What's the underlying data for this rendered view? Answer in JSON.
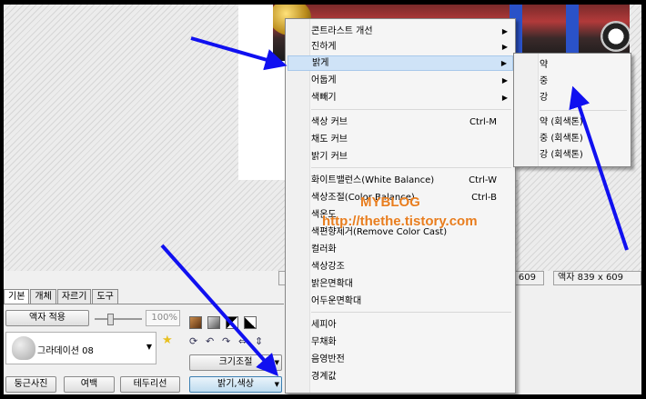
{
  "status_bar": {
    "left_value": "609",
    "right_value": "액자 839 x 609"
  },
  "tabs": [
    {
      "label": "기본"
    },
    {
      "label": "개체"
    },
    {
      "label": "자르기"
    },
    {
      "label": "도구"
    }
  ],
  "panel": {
    "frame_apply": "액자 적용",
    "zoom_value": "100%",
    "gradient_name": "그라데이션 08",
    "resize_button": "크기조절",
    "round_photo": "둥근사진",
    "margin": "여백",
    "border_line": "테두리선",
    "brightness_color": "밝기,색상"
  },
  "menu": {
    "items": [
      {
        "label": "콘트라스트 개선",
        "shortcut": "",
        "submenu": true
      },
      {
        "label": "진하게",
        "shortcut": "",
        "submenu": true
      },
      {
        "label": "밝게",
        "shortcut": "",
        "submenu": true
      },
      {
        "label": "어둡게",
        "shortcut": "",
        "submenu": true
      },
      {
        "label": "색빼기",
        "shortcut": "",
        "submenu": true
      },
      {
        "label": "색상 커브",
        "shortcut": "Ctrl-M",
        "submenu": false
      },
      {
        "label": "채도 커브",
        "shortcut": "",
        "submenu": false
      },
      {
        "label": "밝기 커브",
        "shortcut": "",
        "submenu": false
      },
      {
        "label": "화이트밸런스(White Balance)",
        "shortcut": "Ctrl-W",
        "submenu": false
      },
      {
        "label": "색상조절(Color Balance)",
        "shortcut": "Ctrl-B",
        "submenu": false
      },
      {
        "label": "색온도",
        "shortcut": "",
        "submenu": false
      },
      {
        "label": "색편향제거(Remove Color Cast)",
        "shortcut": "",
        "submenu": false
      },
      {
        "label": "컬러화",
        "shortcut": "",
        "submenu": false
      },
      {
        "label": "색상강조",
        "shortcut": "",
        "submenu": false
      },
      {
        "label": "밝은면확대",
        "shortcut": "",
        "submenu": false
      },
      {
        "label": "어두운면확대",
        "shortcut": "",
        "submenu": false
      },
      {
        "label": "세피아",
        "shortcut": "",
        "submenu": false
      },
      {
        "label": "무채화",
        "shortcut": "",
        "submenu": false
      },
      {
        "label": "음영반전",
        "shortcut": "",
        "submenu": false
      },
      {
        "label": "경계값",
        "shortcut": "",
        "submenu": false
      }
    ]
  },
  "submenu": {
    "items": [
      {
        "label": "약"
      },
      {
        "label": "중"
      },
      {
        "label": "강"
      },
      {
        "label": "약 (회색톤)"
      },
      {
        "label": "중 (회색톤)"
      },
      {
        "label": "강 (회색톤)"
      }
    ]
  },
  "watermark": {
    "line1": "MYBLOG",
    "line2": "http://thethe.tistory.com"
  },
  "icons": {
    "arrow_color": "#1010f0",
    "highlight_color": "#cfe3f7"
  }
}
